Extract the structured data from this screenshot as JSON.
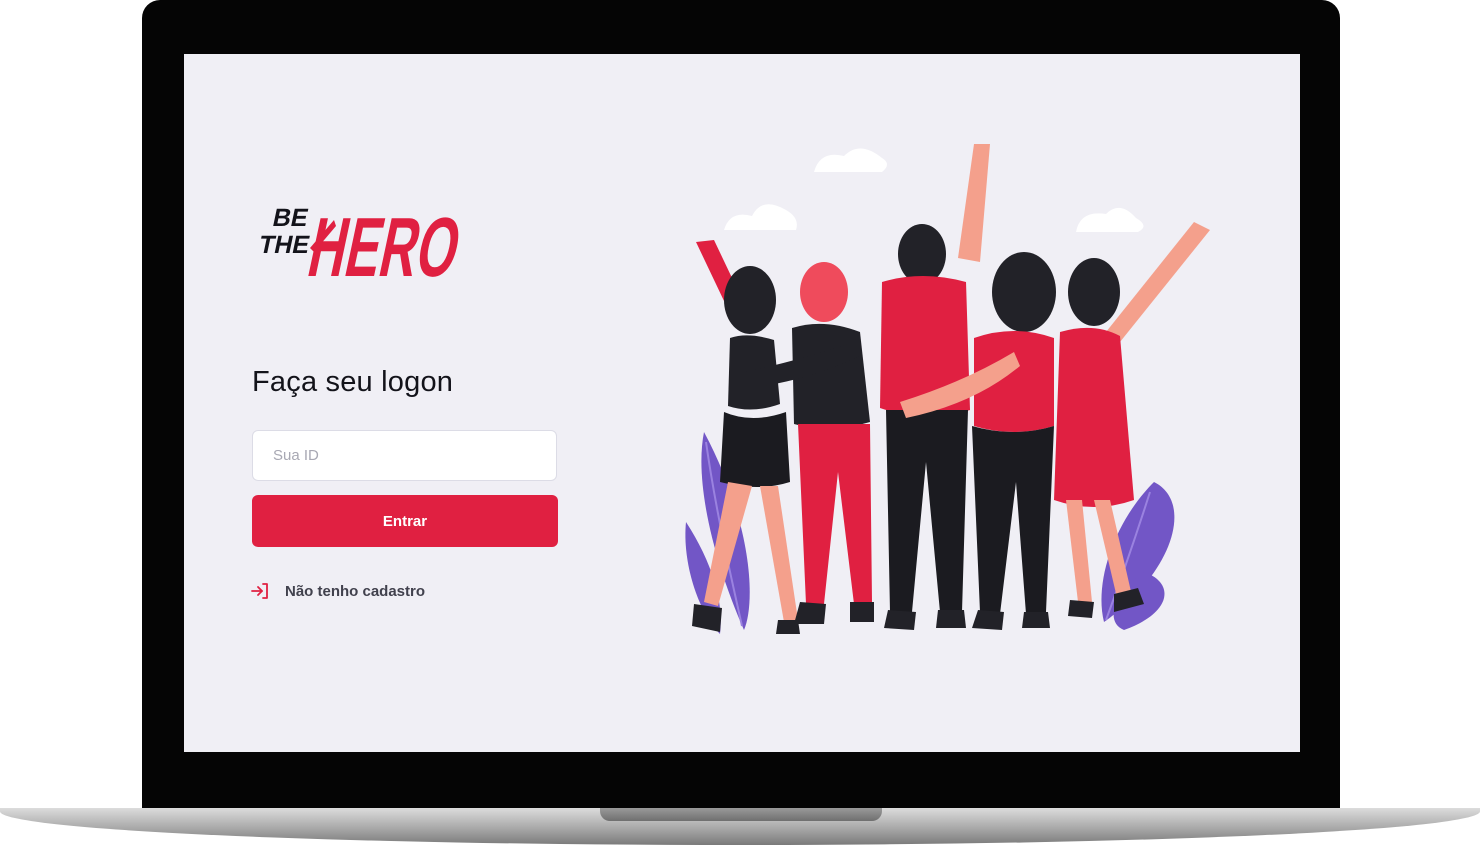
{
  "logo": {
    "small_line_1": "BE",
    "small_line_2": "THE",
    "big_text": "HERO"
  },
  "form": {
    "title": "Faça seu logon",
    "id_input_placeholder": "Sua ID",
    "id_input_value": "",
    "submit_label": "Entrar"
  },
  "register_link": {
    "label": "Não tenho cadastro",
    "icon": "log-in-icon"
  },
  "illustration": {
    "icon": "heroes-group-illustration"
  },
  "colors": {
    "brand": "#e02041",
    "background": "#f0eff5",
    "title_text": "#13131a",
    "link_text": "#41414d",
    "leaf_purple": "#7256c6"
  }
}
